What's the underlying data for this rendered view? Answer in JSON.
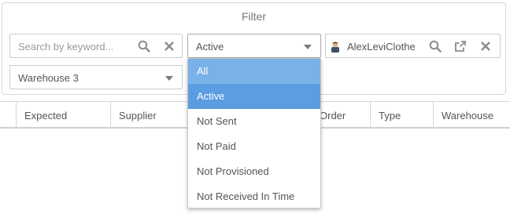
{
  "filter": {
    "title": "Filter",
    "search": {
      "placeholder": "Search by keyword..."
    },
    "status_select": {
      "value": "Active"
    },
    "customer": {
      "value": "AlexLeviClothes"
    },
    "warehouse_select": {
      "value": "Warehouse 3"
    }
  },
  "status_options": [
    "All",
    "Active",
    "Not Sent",
    "Not Paid",
    "Not Provisioned",
    "Not Received In Time"
  ],
  "grid": {
    "columns": [
      "Expected",
      "Supplier",
      "Order",
      "Type",
      "Warehouse"
    ]
  },
  "colors": {
    "option_hover": "#7ab1e8",
    "option_selected": "#5a9de1",
    "border": "#cccccc"
  },
  "icons": {
    "search": "search-icon",
    "clear": "close-icon",
    "open": "external-link-icon",
    "avatar": "user-avatar-icon"
  }
}
